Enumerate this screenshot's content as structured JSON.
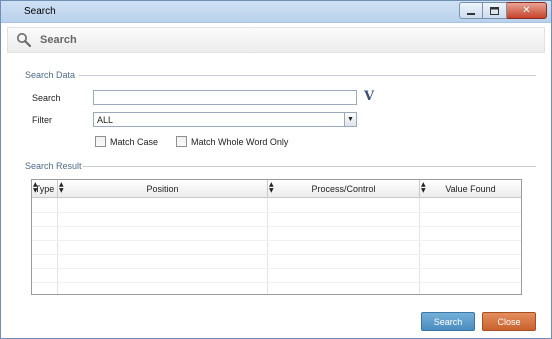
{
  "window": {
    "title": "Search",
    "minimize_icon": "minimize-icon",
    "maximize_icon": "maximize-icon",
    "close_icon": "close-icon",
    "close_glyph": "✕"
  },
  "header": {
    "title": "Search",
    "icon": "magnifier-icon"
  },
  "search_data": {
    "section_label": "Search Data",
    "search_label": "Search",
    "search_value": "",
    "search_option_glyph": "V",
    "filter_label": "Filter",
    "filter_value": "ALL",
    "dropdown_glyph": "▼",
    "match_case_label": "Match Case",
    "match_case_checked": false,
    "match_whole_word_label": "Match Whole Word Only",
    "match_whole_word_checked": false
  },
  "search_result": {
    "section_label": "Search Result",
    "columns": [
      "Type",
      "Position",
      "Process/Control",
      "Value Found"
    ],
    "sort_glyph": "▲▼",
    "rows": []
  },
  "buttons": {
    "search": "Search",
    "close": "Close"
  },
  "colors": {
    "search_button": "#4a8cc0",
    "close_button": "#c9622e",
    "section_label": "#4d6a8a"
  }
}
